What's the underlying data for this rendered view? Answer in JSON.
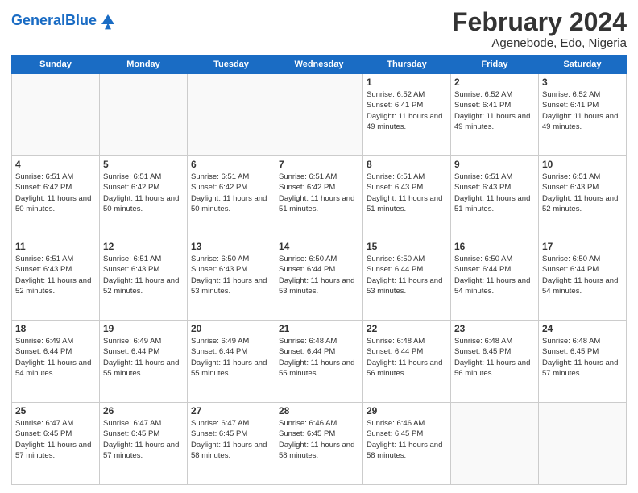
{
  "logo": {
    "text_part1": "General",
    "text_part2": "Blue"
  },
  "title": "February 2024",
  "subtitle": "Agenebode, Edo, Nigeria",
  "weekdays": [
    "Sunday",
    "Monday",
    "Tuesday",
    "Wednesday",
    "Thursday",
    "Friday",
    "Saturday"
  ],
  "weeks": [
    [
      {
        "day": "",
        "info": ""
      },
      {
        "day": "",
        "info": ""
      },
      {
        "day": "",
        "info": ""
      },
      {
        "day": "",
        "info": ""
      },
      {
        "day": "1",
        "info": "Sunrise: 6:52 AM\nSunset: 6:41 PM\nDaylight: 11 hours and 49 minutes."
      },
      {
        "day": "2",
        "info": "Sunrise: 6:52 AM\nSunset: 6:41 PM\nDaylight: 11 hours and 49 minutes."
      },
      {
        "day": "3",
        "info": "Sunrise: 6:52 AM\nSunset: 6:41 PM\nDaylight: 11 hours and 49 minutes."
      }
    ],
    [
      {
        "day": "4",
        "info": "Sunrise: 6:51 AM\nSunset: 6:42 PM\nDaylight: 11 hours and 50 minutes."
      },
      {
        "day": "5",
        "info": "Sunrise: 6:51 AM\nSunset: 6:42 PM\nDaylight: 11 hours and 50 minutes."
      },
      {
        "day": "6",
        "info": "Sunrise: 6:51 AM\nSunset: 6:42 PM\nDaylight: 11 hours and 50 minutes."
      },
      {
        "day": "7",
        "info": "Sunrise: 6:51 AM\nSunset: 6:42 PM\nDaylight: 11 hours and 51 minutes."
      },
      {
        "day": "8",
        "info": "Sunrise: 6:51 AM\nSunset: 6:43 PM\nDaylight: 11 hours and 51 minutes."
      },
      {
        "day": "9",
        "info": "Sunrise: 6:51 AM\nSunset: 6:43 PM\nDaylight: 11 hours and 51 minutes."
      },
      {
        "day": "10",
        "info": "Sunrise: 6:51 AM\nSunset: 6:43 PM\nDaylight: 11 hours and 52 minutes."
      }
    ],
    [
      {
        "day": "11",
        "info": "Sunrise: 6:51 AM\nSunset: 6:43 PM\nDaylight: 11 hours and 52 minutes."
      },
      {
        "day": "12",
        "info": "Sunrise: 6:51 AM\nSunset: 6:43 PM\nDaylight: 11 hours and 52 minutes."
      },
      {
        "day": "13",
        "info": "Sunrise: 6:50 AM\nSunset: 6:43 PM\nDaylight: 11 hours and 53 minutes."
      },
      {
        "day": "14",
        "info": "Sunrise: 6:50 AM\nSunset: 6:44 PM\nDaylight: 11 hours and 53 minutes."
      },
      {
        "day": "15",
        "info": "Sunrise: 6:50 AM\nSunset: 6:44 PM\nDaylight: 11 hours and 53 minutes."
      },
      {
        "day": "16",
        "info": "Sunrise: 6:50 AM\nSunset: 6:44 PM\nDaylight: 11 hours and 54 minutes."
      },
      {
        "day": "17",
        "info": "Sunrise: 6:50 AM\nSunset: 6:44 PM\nDaylight: 11 hours and 54 minutes."
      }
    ],
    [
      {
        "day": "18",
        "info": "Sunrise: 6:49 AM\nSunset: 6:44 PM\nDaylight: 11 hours and 54 minutes."
      },
      {
        "day": "19",
        "info": "Sunrise: 6:49 AM\nSunset: 6:44 PM\nDaylight: 11 hours and 55 minutes."
      },
      {
        "day": "20",
        "info": "Sunrise: 6:49 AM\nSunset: 6:44 PM\nDaylight: 11 hours and 55 minutes."
      },
      {
        "day": "21",
        "info": "Sunrise: 6:48 AM\nSunset: 6:44 PM\nDaylight: 11 hours and 55 minutes."
      },
      {
        "day": "22",
        "info": "Sunrise: 6:48 AM\nSunset: 6:44 PM\nDaylight: 11 hours and 56 minutes."
      },
      {
        "day": "23",
        "info": "Sunrise: 6:48 AM\nSunset: 6:45 PM\nDaylight: 11 hours and 56 minutes."
      },
      {
        "day": "24",
        "info": "Sunrise: 6:48 AM\nSunset: 6:45 PM\nDaylight: 11 hours and 57 minutes."
      }
    ],
    [
      {
        "day": "25",
        "info": "Sunrise: 6:47 AM\nSunset: 6:45 PM\nDaylight: 11 hours and 57 minutes."
      },
      {
        "day": "26",
        "info": "Sunrise: 6:47 AM\nSunset: 6:45 PM\nDaylight: 11 hours and 57 minutes."
      },
      {
        "day": "27",
        "info": "Sunrise: 6:47 AM\nSunset: 6:45 PM\nDaylight: 11 hours and 58 minutes."
      },
      {
        "day": "28",
        "info": "Sunrise: 6:46 AM\nSunset: 6:45 PM\nDaylight: 11 hours and 58 minutes."
      },
      {
        "day": "29",
        "info": "Sunrise: 6:46 AM\nSunset: 6:45 PM\nDaylight: 11 hours and 58 minutes."
      },
      {
        "day": "",
        "info": ""
      },
      {
        "day": "",
        "info": ""
      }
    ]
  ]
}
